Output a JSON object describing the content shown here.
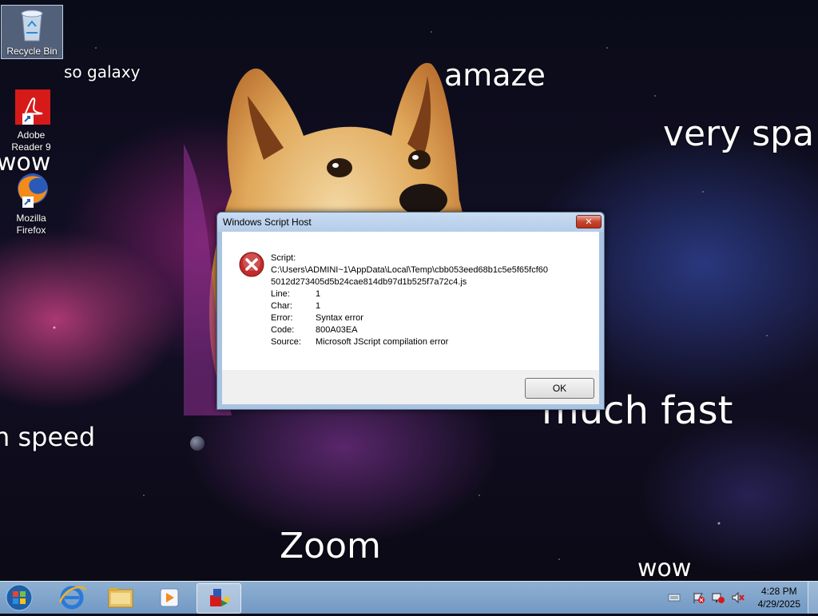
{
  "desktop": {
    "icons": [
      {
        "label": "Recycle Bin",
        "icon": "recycle-bin-icon"
      },
      {
        "label": "Adobe Reader 9",
        "icon": "adobe-reader-icon"
      },
      {
        "label": "Mozilla Firefox",
        "icon": "firefox-icon"
      }
    ],
    "wallpaper_text": [
      "so galaxy",
      "amaze",
      "very spa",
      "wow",
      "much fast",
      "n speed",
      "Zoom",
      "wow"
    ]
  },
  "dialog": {
    "title": "Windows Script Host",
    "close_label": "✕",
    "icon": "error-icon",
    "script_label": "Script:",
    "script_path_line1": "C:\\Users\\ADMINI~1\\AppData\\Local\\Temp\\cbb053eed68b1c5e5f65fcf60",
    "script_path_line2": "5012d273405d5b24cae814db97d1b525f7a72c4.js",
    "fields": [
      {
        "key": "Line:",
        "value": "1"
      },
      {
        "key": "Char:",
        "value": "1"
      },
      {
        "key": "Error:",
        "value": "Syntax error"
      },
      {
        "key": "Code:",
        "value": "800A03EA"
      },
      {
        "key": "Source:",
        "value": "Microsoft JScript compilation error"
      }
    ],
    "ok_label": "OK"
  },
  "taskbar": {
    "start_icon": "windows-start-icon",
    "pinned": [
      "internet-explorer-icon",
      "file-explorer-icon",
      "media-player-icon",
      "script-host-icon"
    ],
    "tray": [
      "keyboard-icon",
      "action-center-icon",
      "network-icon",
      "volume-muted-icon"
    ],
    "time": "4:28 PM",
    "date": "4/29/2025"
  }
}
